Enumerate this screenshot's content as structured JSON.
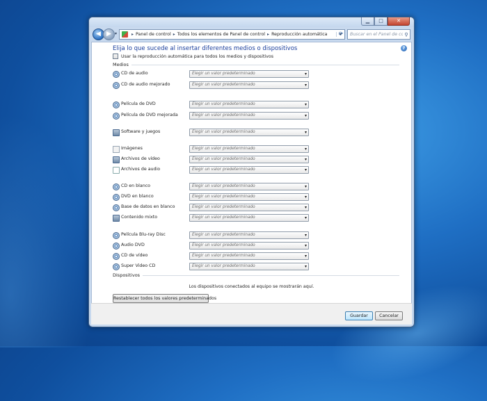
{
  "window": {
    "minimize_glyph": "▁",
    "maximize_glyph": "□",
    "close_glyph": "✕"
  },
  "navigation": {
    "back_glyph": "◀",
    "forward_glyph": "▶",
    "breadcrumb": [
      "Panel de control",
      "Todos los elementos de Panel de control",
      "Reproducción automática"
    ],
    "breadcrumb_separator": "▸",
    "search_placeholder": "Buscar en el Panel de control",
    "icons": [
      "back-arrow-icon",
      "forward-arrow-icon",
      "control-panel-icon",
      "refresh-icon",
      "search-icon"
    ]
  },
  "page": {
    "title": "Elija lo que sucede al insertar diferentes medios o dispositivos",
    "autoplay_checkbox_label": "Usar la reproducción automática para todos los medios y dispositivos",
    "help_glyph": "?",
    "media_group_label": "Medios",
    "devices_group_label": "Dispositivos",
    "devices_message": "Los dispositivos conectados al equipo se mostrarán aquí.",
    "reset_label": "Restablecer todos los valores predeterminados",
    "default_option": "Elegir un valor predeterminado"
  },
  "media_items": [
    {
      "label": "CD de audio",
      "icon": "cd-icon"
    },
    {
      "label": "CD de audio mejorado",
      "icon": "cd-icon"
    },
    {
      "label": "Película de DVD",
      "icon": "dvd-icon"
    },
    {
      "label": "Película de DVD mejorada",
      "icon": "dvd-icon"
    },
    {
      "label": "Software y juegos",
      "icon": "software-icon"
    },
    {
      "label": "Imágenes",
      "icon": "image-file-icon"
    },
    {
      "label": "Archivos de vídeo",
      "icon": "video-file-icon"
    },
    {
      "label": "Archivos de audio",
      "icon": "audio-file-icon"
    },
    {
      "label": "CD en blanco",
      "icon": "blank-cd-icon"
    },
    {
      "label": "DVD en blanco",
      "icon": "blank-dvd-icon"
    },
    {
      "label": "Base de datos en blanco",
      "icon": "disc-icon"
    },
    {
      "label": "Contenido mixto",
      "icon": "mixed-content-icon"
    },
    {
      "label": "Película Blu-ray Disc",
      "icon": "bluray-icon"
    },
    {
      "label": "Audio DVD",
      "icon": "dvd-icon"
    },
    {
      "label": "CD de vídeo",
      "icon": "cd-icon"
    },
    {
      "label": "Super Video CD",
      "icon": "cd-icon"
    }
  ],
  "buttons": {
    "save": "Guardar",
    "cancel": "Cancelar"
  }
}
